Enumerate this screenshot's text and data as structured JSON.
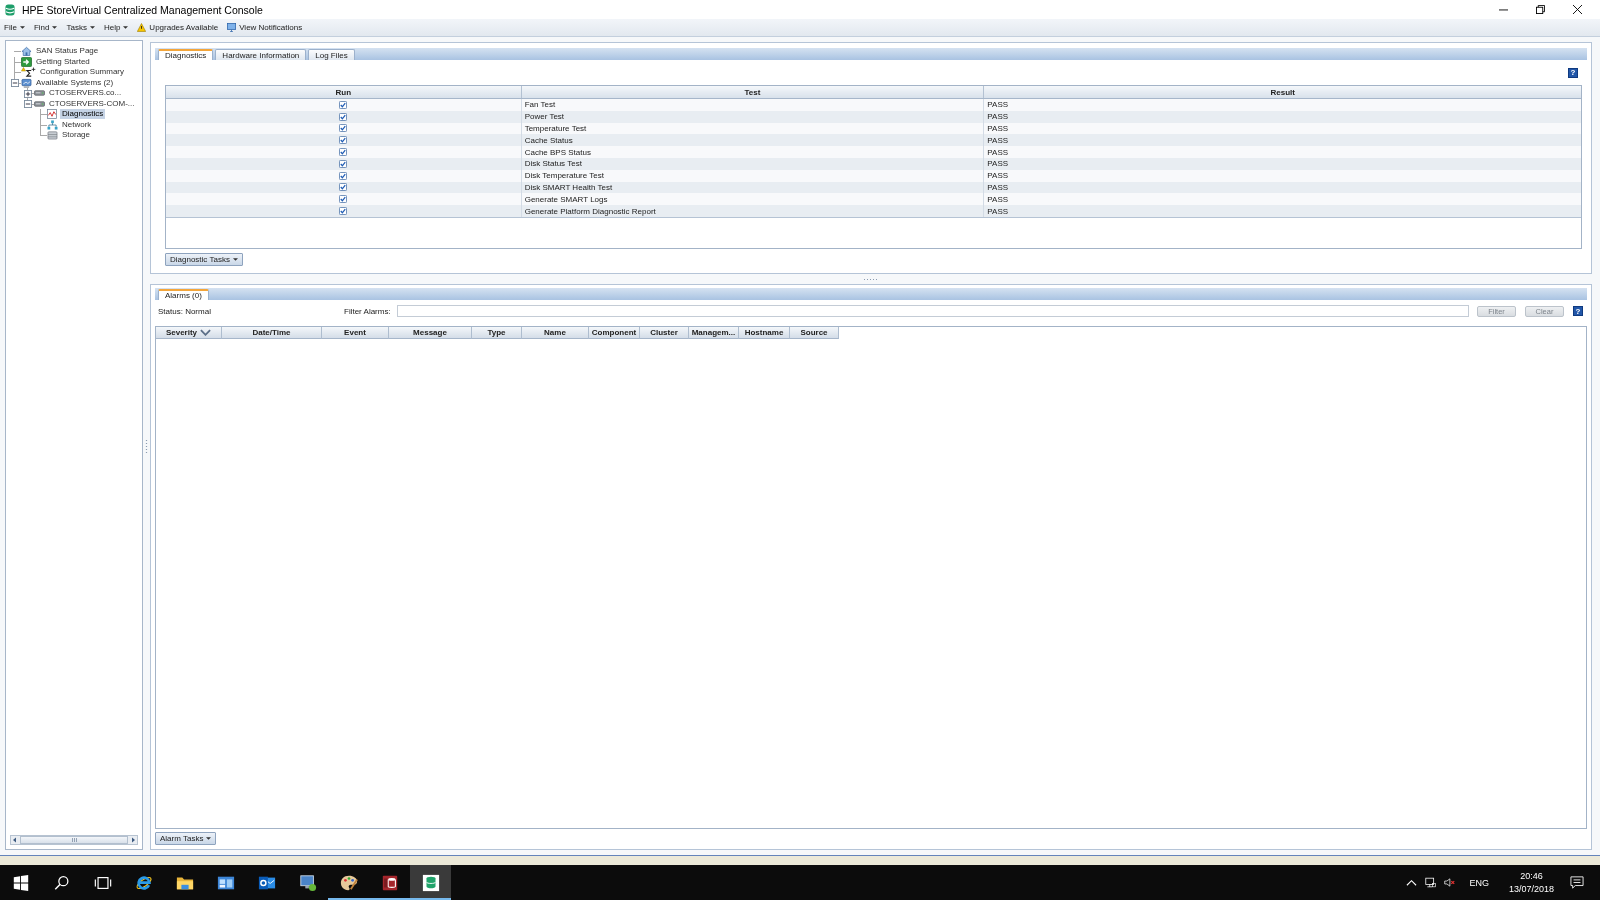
{
  "window": {
    "title": "HPE StoreVirtual Centralized Management Console"
  },
  "menu": [
    {
      "label": "File",
      "kind": "dropdown"
    },
    {
      "label": "Find",
      "kind": "dropdown"
    },
    {
      "label": "Tasks",
      "kind": "dropdown"
    },
    {
      "label": "Help",
      "kind": "dropdown"
    },
    {
      "label": "Upgrades Available",
      "kind": "warning"
    },
    {
      "label": "View Notifications",
      "kind": "notifications"
    }
  ],
  "tree": [
    {
      "label": "SAN Status Page",
      "kind": "status",
      "selected": false
    },
    {
      "label": "Getting Started",
      "kind": "start",
      "selected": false
    },
    {
      "label": "Configuration Summary",
      "kind": "summary",
      "selected": false
    },
    {
      "label": "Available Systems (2)",
      "kind": "systems",
      "selected": false,
      "expanded": true,
      "children": [
        {
          "label": "CTOSERVERS.co...",
          "kind": "server",
          "selected": false,
          "expanded": false
        },
        {
          "label": "CTOSERVERS-COM-...",
          "kind": "server",
          "selected": false,
          "expanded": true,
          "children": [
            {
              "label": "Diagnostics",
              "kind": "diagnostics",
              "selected": true
            },
            {
              "label": "Network",
              "kind": "network",
              "selected": false
            },
            {
              "label": "Storage",
              "kind": "storage",
              "selected": false
            }
          ]
        }
      ]
    }
  ],
  "diagnostics": {
    "tabs": [
      {
        "label": "Diagnostics",
        "selected": true
      },
      {
        "label": "Hardware Information",
        "selected": false
      },
      {
        "label": "Log Files",
        "selected": false
      }
    ],
    "help": "?",
    "table": {
      "columns": [
        "Run",
        "Test",
        "Result"
      ],
      "rows": [
        {
          "checked": true,
          "test": "Fan Test",
          "result": "PASS"
        },
        {
          "checked": true,
          "test": "Power Test",
          "result": "PASS"
        },
        {
          "checked": true,
          "test": "Temperature Test",
          "result": "PASS"
        },
        {
          "checked": true,
          "test": "Cache Status",
          "result": "PASS"
        },
        {
          "checked": true,
          "test": "Cache BPS Status",
          "result": "PASS"
        },
        {
          "checked": true,
          "test": "Disk Status Test",
          "result": "PASS"
        },
        {
          "checked": true,
          "test": "Disk Temperature Test",
          "result": "PASS"
        },
        {
          "checked": true,
          "test": "Disk SMART Health Test",
          "result": "PASS"
        },
        {
          "checked": true,
          "test": "Generate SMART Logs",
          "result": "PASS"
        },
        {
          "checked": true,
          "test": "Generate Platform Diagnostic Report",
          "result": "PASS"
        }
      ]
    },
    "tasks_button": "Diagnostic Tasks"
  },
  "alarms": {
    "tabs": [
      {
        "label": "Alarms (0)",
        "selected": true
      }
    ],
    "status": "Status: Normal",
    "filter_label": "Filter Alarms:",
    "buttons": [
      {
        "label": "Filter",
        "disabled": true
      },
      {
        "label": "Clear",
        "disabled": true
      }
    ],
    "help": "?",
    "table": {
      "columns": [
        {
          "label": "Severity",
          "sorted": true
        },
        {
          "label": "Date/Time",
          "sorted": false
        },
        {
          "label": "Event",
          "sorted": false
        },
        {
          "label": "Message",
          "sorted": false
        },
        {
          "label": "Type",
          "sorted": false
        },
        {
          "label": "Name",
          "sorted": false
        },
        {
          "label": "Component",
          "sorted": false
        },
        {
          "label": "Cluster",
          "sorted": false
        },
        {
          "label": "Managem...",
          "sorted": false
        },
        {
          "label": "Hostname",
          "sorted": false
        },
        {
          "label": "Source",
          "sorted": false
        }
      ]
    },
    "tasks_button": "Alarm Tasks"
  },
  "taskbar": {
    "apps": [
      {
        "kind": "start",
        "running": false,
        "selected": false
      },
      {
        "kind": "search",
        "running": false,
        "selected": false
      },
      {
        "kind": "taskview",
        "running": false,
        "selected": false
      },
      {
        "kind": "browser",
        "running": false,
        "selected": false
      },
      {
        "kind": "explorer",
        "running": false,
        "selected": false
      },
      {
        "kind": "control",
        "running": false,
        "selected": false
      },
      {
        "kind": "mail",
        "running": false,
        "selected": false
      },
      {
        "kind": "remote",
        "running": false,
        "selected": false
      },
      {
        "kind": "paint",
        "running": true,
        "selected": false
      },
      {
        "kind": "access",
        "running": true,
        "selected": false
      },
      {
        "kind": "console",
        "running": true,
        "selected": true
      }
    ],
    "tray": {
      "language": "ENG",
      "time": "20:46",
      "date": "13/07/2018"
    }
  }
}
